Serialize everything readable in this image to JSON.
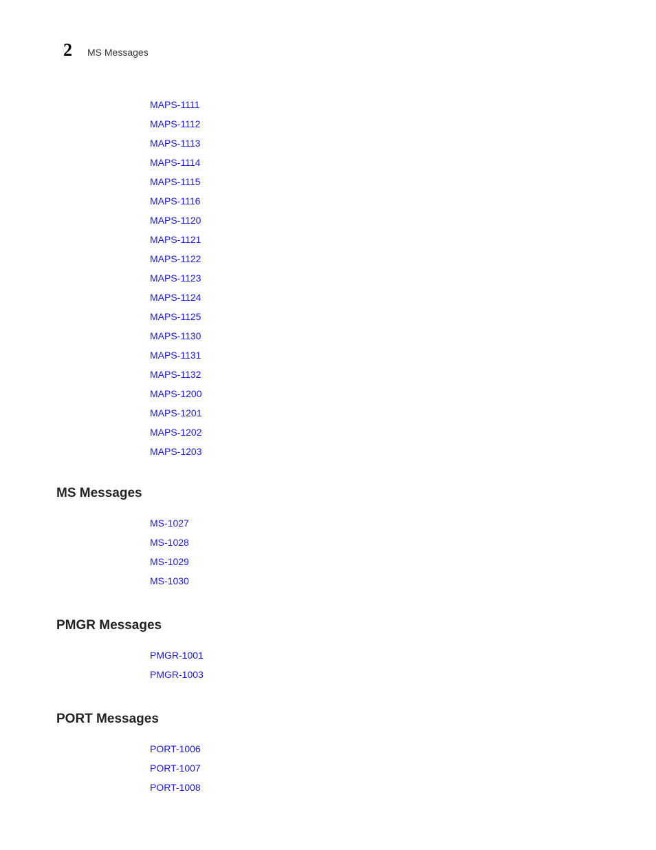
{
  "header": {
    "chapter_number": "2",
    "chapter_title": "MS Messages"
  },
  "maps_links": [
    "MAPS-1111",
    "MAPS-1112",
    "MAPS-1113",
    "MAPS-1114",
    "MAPS-1115",
    "MAPS-1116",
    "MAPS-1120",
    "MAPS-1121",
    "MAPS-1122",
    "MAPS-1123",
    "MAPS-1124",
    "MAPS-1125",
    "MAPS-1130",
    "MAPS-1131",
    "MAPS-1132",
    "MAPS-1200",
    "MAPS-1201",
    "MAPS-1202",
    "MAPS-1203"
  ],
  "sections": [
    {
      "heading": "MS Messages",
      "links": [
        "MS-1027",
        "MS-1028",
        "MS-1029",
        "MS-1030"
      ]
    },
    {
      "heading": "PMGR Messages",
      "links": [
        "PMGR-1001",
        "PMGR-1003"
      ]
    },
    {
      "heading": "PORT Messages",
      "links": [
        "PORT-1006",
        "PORT-1007",
        "PORT-1008"
      ]
    }
  ]
}
